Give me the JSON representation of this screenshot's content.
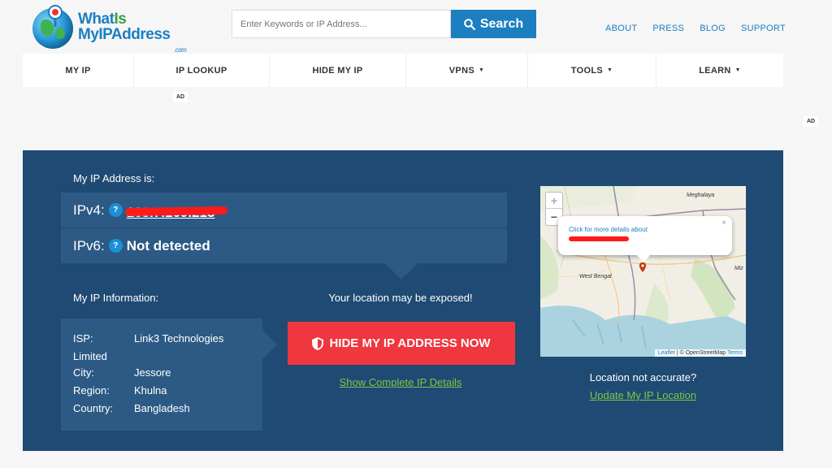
{
  "logo": {
    "line1_a": "What",
    "line1_b": "Is",
    "line2": "MyIPAddress",
    "dotcom": ".com"
  },
  "search": {
    "placeholder": "Enter Keywords or IP Address...",
    "button_label": "Search"
  },
  "toplinks": [
    "ABOUT",
    "PRESS",
    "BLOG",
    "SUPPORT"
  ],
  "nav": [
    {
      "label": "MY IP",
      "caret": ""
    },
    {
      "label": "IP LOOKUP",
      "caret": ""
    },
    {
      "label": "HIDE MY IP",
      "caret": ""
    },
    {
      "label": "VPNS",
      "caret": "▼"
    },
    {
      "label": "TOOLS",
      "caret": "▼"
    },
    {
      "label": "LEARN",
      "caret": "▼"
    }
  ],
  "ads": {
    "left": "AD",
    "right": "AD"
  },
  "panel": {
    "myip_label": "My IP Address is:",
    "ipv4_label": "IPv4:",
    "ipv4_value": "103.7.169.213",
    "ipv6_label": "IPv6:",
    "ipv6_value": "Not detected",
    "help_glyph": "?",
    "info_label": "My IP Information:",
    "isp_key": "ISP:",
    "isp_value": "Link3 Technologies",
    "isp_value_cont": "Limited",
    "city_key": "City:",
    "city_value": "Jessore",
    "region_key": "Region:",
    "region_value": "Khulna",
    "country_key": "Country:",
    "country_value": "Bangladesh",
    "exposed_text": "Your location may be exposed!",
    "hide_button": "HIDE MY IP ADDRESS NOW",
    "details_link": "Show Complete IP Details",
    "not_accurate": "Location not accurate?",
    "update_link": "Update My IP Location"
  },
  "map": {
    "zoom_in": "+",
    "zoom_out": "−",
    "popup_text": "Click for more details about",
    "popup_close": "×",
    "label_meghalaya": "Meghalaya",
    "label_westbengal": "West Bengal",
    "label_mi": "Miz",
    "attrib_leaflet": "Leaflet",
    "attrib_sep": " | © OpenStreetMap ",
    "attrib_terms": "Terms"
  },
  "colors": {
    "brand_blue": "#1b7fc1",
    "panel_bg": "#1f4a73",
    "row_bg": "#2c5a84",
    "cta_red": "#f0363e",
    "link_green": "#7ac943"
  }
}
